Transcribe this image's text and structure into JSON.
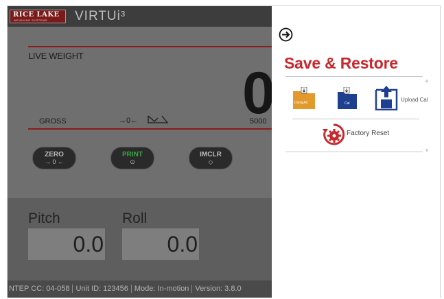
{
  "app": {
    "brand": {
      "name": "RICE LAKE",
      "subtitle": "WEIGHING SYSTEMS",
      "product": "VIRTUi³"
    },
    "weight": {
      "title": "LIVE WEIGHT",
      "value": "0",
      "mode": "GROSS",
      "capacity": "5000"
    },
    "soft_buttons": [
      {
        "label": "ZERO",
        "icon": "→ 0 ←"
      },
      {
        "label": "PRINT",
        "icon": "⊙"
      },
      {
        "label": "IMCLR",
        "icon": "◇"
      }
    ],
    "readouts": [
      {
        "label": "Pitch",
        "value": "0.0"
      },
      {
        "label": "Roll",
        "value": "0.0"
      }
    ],
    "status": [
      "NTEP CC: 04-058",
      "Unit ID: 123456",
      "Mode: In-motion",
      "Version: 3.8.0"
    ]
  },
  "drawer": {
    "title": "Save & Restore",
    "dump_all_label": "DumpAll",
    "cal_label": "Cal",
    "upload_cal_label": "Upload Cal",
    "factory_reset_label": "Factory Reset"
  },
  "colors": {
    "accent_red": "#c8272c",
    "dump_all_orange": "#e39a2b",
    "cal_blue": "#1f3f8f",
    "dim_overlay": "#686868"
  },
  "icons": [
    "back-arrow-icon",
    "dump-all-icon",
    "cal-icon",
    "upload-cal-icon",
    "factory-reset-icon",
    "standstill-icon",
    "motion-icon"
  ]
}
